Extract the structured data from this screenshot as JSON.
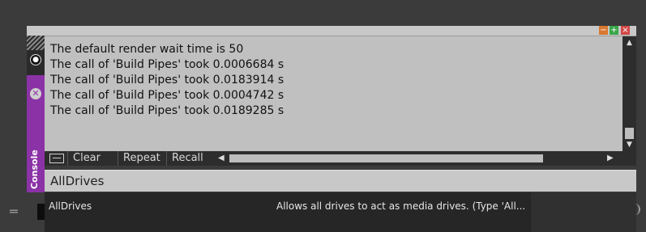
{
  "window": {
    "controls": {
      "minimize": "−",
      "maximize": "+",
      "close": "×"
    }
  },
  "sidebar": {
    "label": "Console",
    "pin_icon": "●",
    "close_icon": "✕"
  },
  "console": {
    "lines": [
      "The default render wait time is 50",
      "The call of 'Build Pipes' took 0.0006684 s",
      "The call of 'Build Pipes' took 0.0183914 s",
      "The call of 'Build Pipes' took 0.0004742 s",
      "The call of 'Build Pipes' took 0.0189285 s"
    ],
    "scroll_up": "▲",
    "scroll_down": "▼",
    "scroll_left": "◀",
    "scroll_right": "▶"
  },
  "toolbar": {
    "clear_label": "Clear",
    "repeat_label": "Repeat",
    "recall_label": "Recall"
  },
  "input": {
    "value": "AllDrives"
  },
  "autocomplete": {
    "items": [
      {
        "name": "AllDrives",
        "description": "Allows all drives to act as media drives. (Type 'All..."
      }
    ]
  },
  "colors": {
    "accent": "#8b32a6",
    "console_bg": "#c0c0c0",
    "app_bg": "#3b3b3b"
  }
}
